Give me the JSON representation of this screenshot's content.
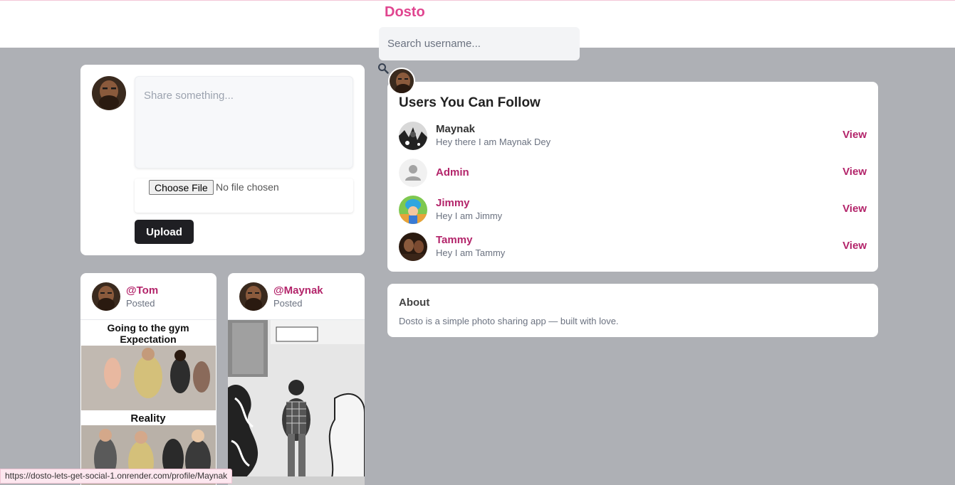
{
  "header": {
    "brand": "Dosto",
    "search_placeholder": "Search username..."
  },
  "composer": {
    "placeholder": "Share something...",
    "choose_file_label": "Choose File",
    "file_status": "No file chosen",
    "upload_label": "Upload"
  },
  "posts": [
    {
      "user": "@Tom",
      "meta": "Posted",
      "image_caption_top": "Going to the gym Expectation",
      "image_caption_bottom": "Reality"
    },
    {
      "user": "@Maynak",
      "meta": "Posted"
    }
  ],
  "follow": {
    "title": "Users You Can Follow",
    "users": [
      {
        "name": "Maynak",
        "bio": "Hey there I am Maynak Dey",
        "action": "View"
      },
      {
        "name": "Admin",
        "bio": "",
        "action": "View"
      },
      {
        "name": "Jimmy",
        "bio": "Hey I am Jimmy",
        "action": "View"
      },
      {
        "name": "Tammy",
        "bio": "Hey I am Tammy",
        "action": "View"
      }
    ]
  },
  "about": {
    "title": "About",
    "text": "Dosto is a simple photo sharing app — built with love."
  },
  "status_bar": {
    "url": "https://dosto-lets-get-social-1.onrender.com/profile/Maynak"
  },
  "colors": {
    "brand": "#e0458f",
    "accent": "#b3246a",
    "page_bg": "#aeb0b5",
    "button_dark": "#1f1f23"
  }
}
